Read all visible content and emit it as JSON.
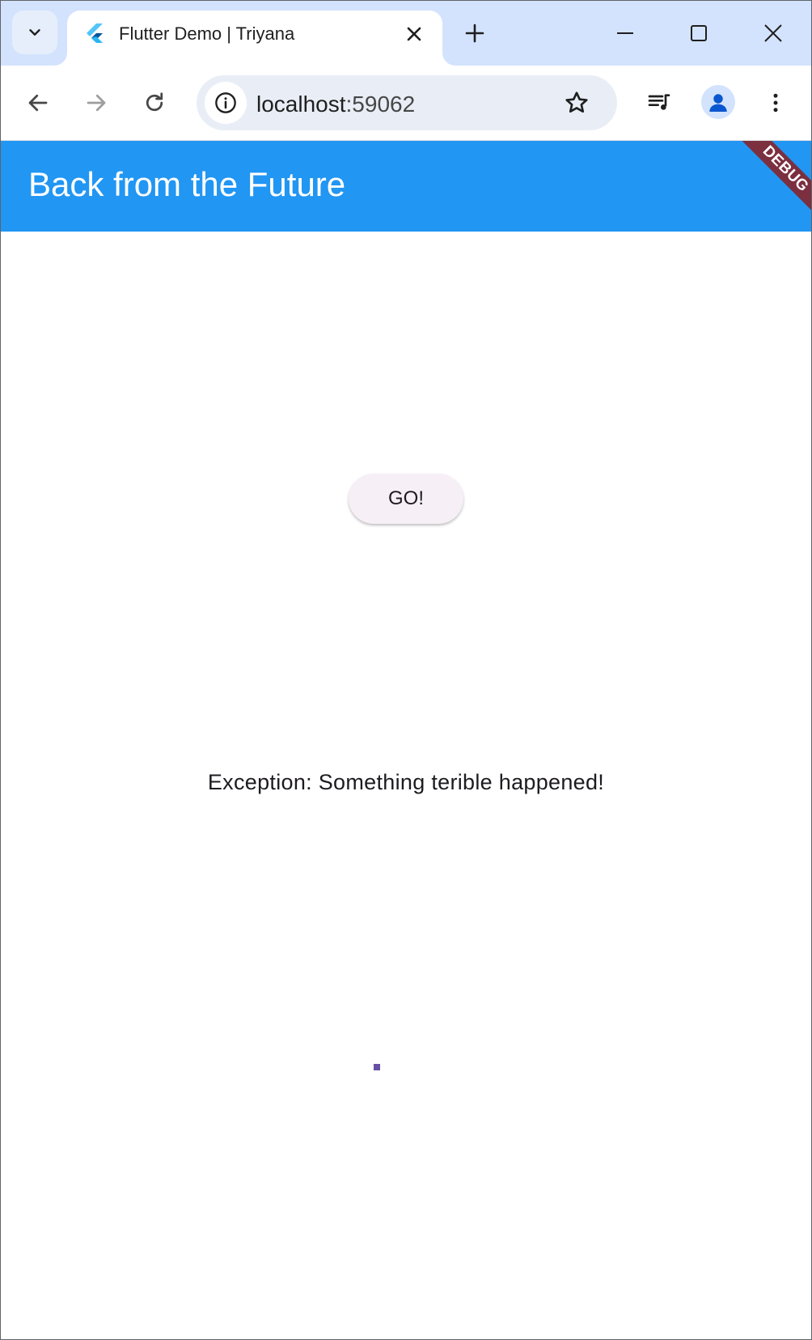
{
  "browser": {
    "tab": {
      "title": "Flutter Demo | Triyana"
    },
    "omnibox": {
      "host": "localhost",
      "port": ":59062"
    }
  },
  "app": {
    "appbar_title": "Back from the Future",
    "debug_banner": "DEBUG",
    "go_button_label": "GO!",
    "result_text": "Exception: Something terible happened!",
    "colors": {
      "appbar": "#2196f3",
      "debug_banner": "#7b2f3f",
      "button_bg": "#f6eff6",
      "spinner": "#6750a4"
    }
  },
  "icons": {
    "tab_search": "chevron-down-icon",
    "favicon": "flutter-logo-icon",
    "tab_close": "close-icon",
    "new_tab": "plus-icon",
    "minimize": "minimize-icon",
    "maximize": "maximize-icon",
    "close_window": "close-icon",
    "back": "arrow-left-icon",
    "forward": "arrow-right-icon",
    "reload": "reload-icon",
    "site_info": "info-icon",
    "bookmark": "star-icon",
    "media": "playlist-music-icon",
    "profile": "person-icon",
    "menu": "more-vert-icon"
  }
}
